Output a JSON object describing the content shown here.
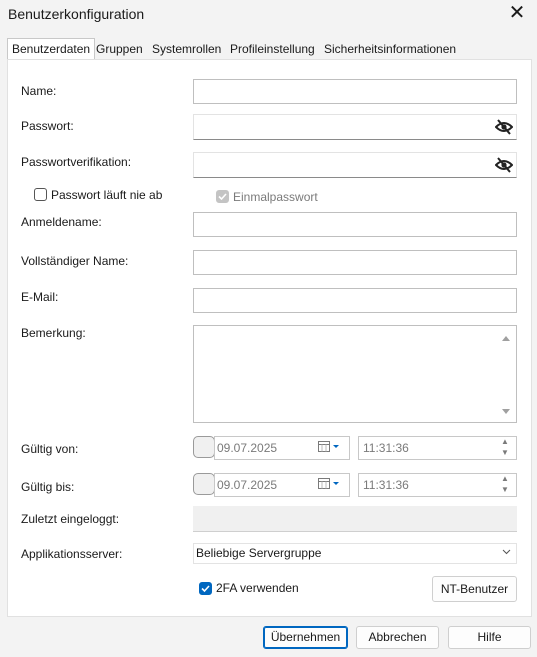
{
  "window": {
    "title": "Benutzerkonfiguration",
    "close_glyph": "✕"
  },
  "tabs": [
    {
      "label": "Benutzerdaten",
      "active": true
    },
    {
      "label": "Gruppen"
    },
    {
      "label": "Systemrollen"
    },
    {
      "label": "Profileinstellung"
    },
    {
      "label": "Sicherheitsinformationen"
    }
  ],
  "form": {
    "name_label": "Name:",
    "password_label": "Passwort:",
    "password_verify_label": "Passwortverifikation:",
    "never_expires_label": "Passwort läuft nie ab",
    "one_time_label": "Einmalpasswort",
    "login_name_label": "Anmeldename:",
    "full_name_label": "Vollständiger Name:",
    "email_label": "E-Mail:",
    "remark_label": "Bemerkung:",
    "valid_from_label": "Gültig von:",
    "valid_from_date": "09.07.2025",
    "valid_from_time": "11:31:36",
    "valid_to_label": "Gültig bis:",
    "valid_to_date": "09.07.2025",
    "valid_to_time": "11:31:36",
    "last_login_label": "Zuletzt eingeloggt:",
    "app_server_label": "Applikationsserver:",
    "app_server_value": "Beliebige Servergruppe",
    "twofa_label": "2FA verwenden",
    "nt_user_button": "NT-Benutzer"
  },
  "footer": {
    "apply": "Übernehmen",
    "cancel": "Abbrechen",
    "help": "Hilfe"
  },
  "colors": {
    "accent": "#0067c0",
    "background": "#f3f3f3"
  }
}
